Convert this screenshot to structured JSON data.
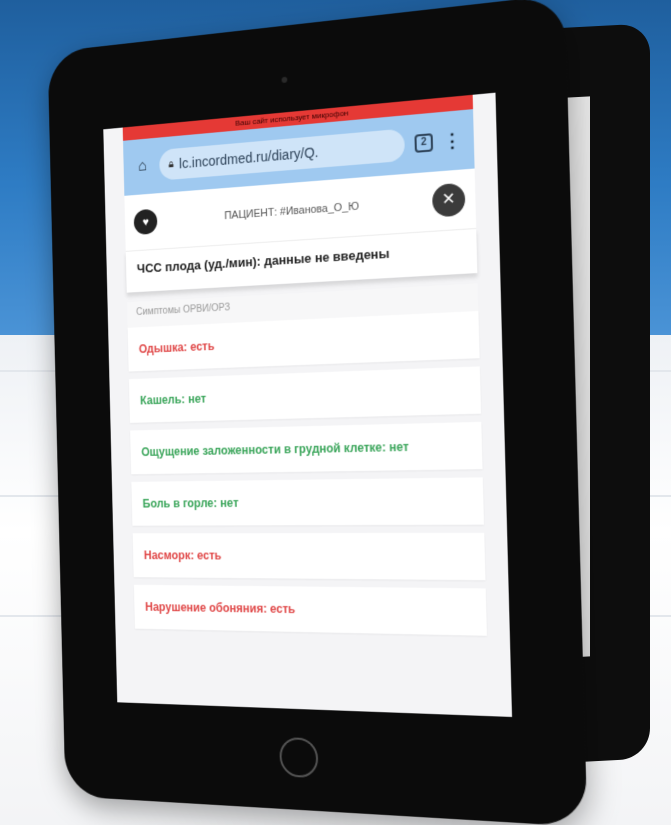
{
  "browser": {
    "notice": "Ваш сайт использует микрофон",
    "url": "lc.incordmed.ru/diary/Q.",
    "tabs_count": "2"
  },
  "patient": {
    "label": "ПАЦИЕНТ: #Иванова_О_Ю"
  },
  "fhr": {
    "text": "ЧСС плода (уд./мин): данные не введены"
  },
  "section": {
    "title": "Симптомы ОРВИ/ОРЗ"
  },
  "symptoms": [
    {
      "label": "Одышка: есть",
      "status": "red"
    },
    {
      "label": "Кашель: нет",
      "status": "green"
    },
    {
      "label": "Ощущение заложенности в грудной клетке: нет",
      "status": "green"
    },
    {
      "label": "Боль в горле: нет",
      "status": "green"
    },
    {
      "label": "Насморк: есть",
      "status": "red"
    },
    {
      "label": "Нарушение обоняния: есть",
      "status": "red"
    }
  ],
  "colors": {
    "present": "#e04848",
    "absent": "#3aa55a",
    "address_bar": "#9fc9f0",
    "notice_bar": "#e53935"
  }
}
